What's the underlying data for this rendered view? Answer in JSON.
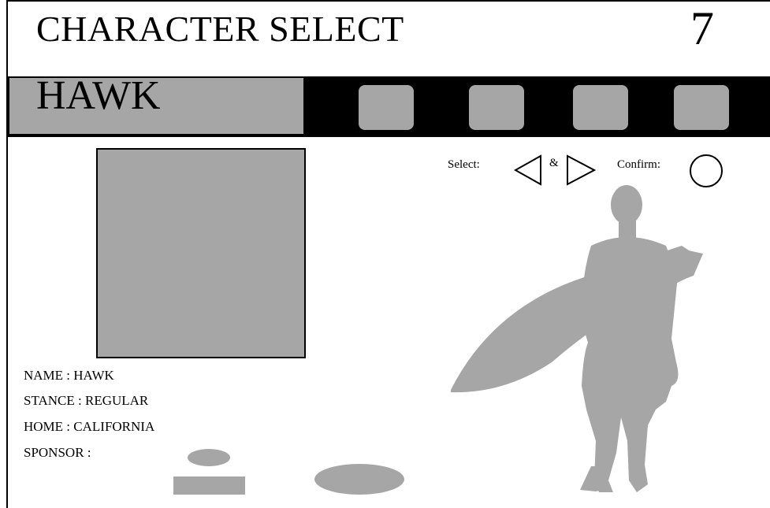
{
  "header": {
    "title": "CHARACTER SELECT",
    "timer": "7"
  },
  "selected_character": {
    "name_tab": "HAWK"
  },
  "character_slots": [
    {
      "icon": "character-slot"
    },
    {
      "icon": "character-slot"
    },
    {
      "icon": "character-slot"
    },
    {
      "icon": "character-slot"
    }
  ],
  "controls": {
    "select_label": "Select:",
    "and_label": "&",
    "confirm_label": "Confirm:",
    "left_icon": "triangle-left-icon",
    "right_icon": "triangle-right-icon",
    "confirm_icon": "circle-button-icon"
  },
  "stats": {
    "name": "NAME : HAWK",
    "stance": "STANCE : REGULAR",
    "home": "HOME : CALIFORNIA",
    "sponsor": "SPONSOR :"
  },
  "colors": {
    "placeholder_gray": "#a6a6a6",
    "bar_black": "#000000",
    "background": "#ffffff"
  }
}
